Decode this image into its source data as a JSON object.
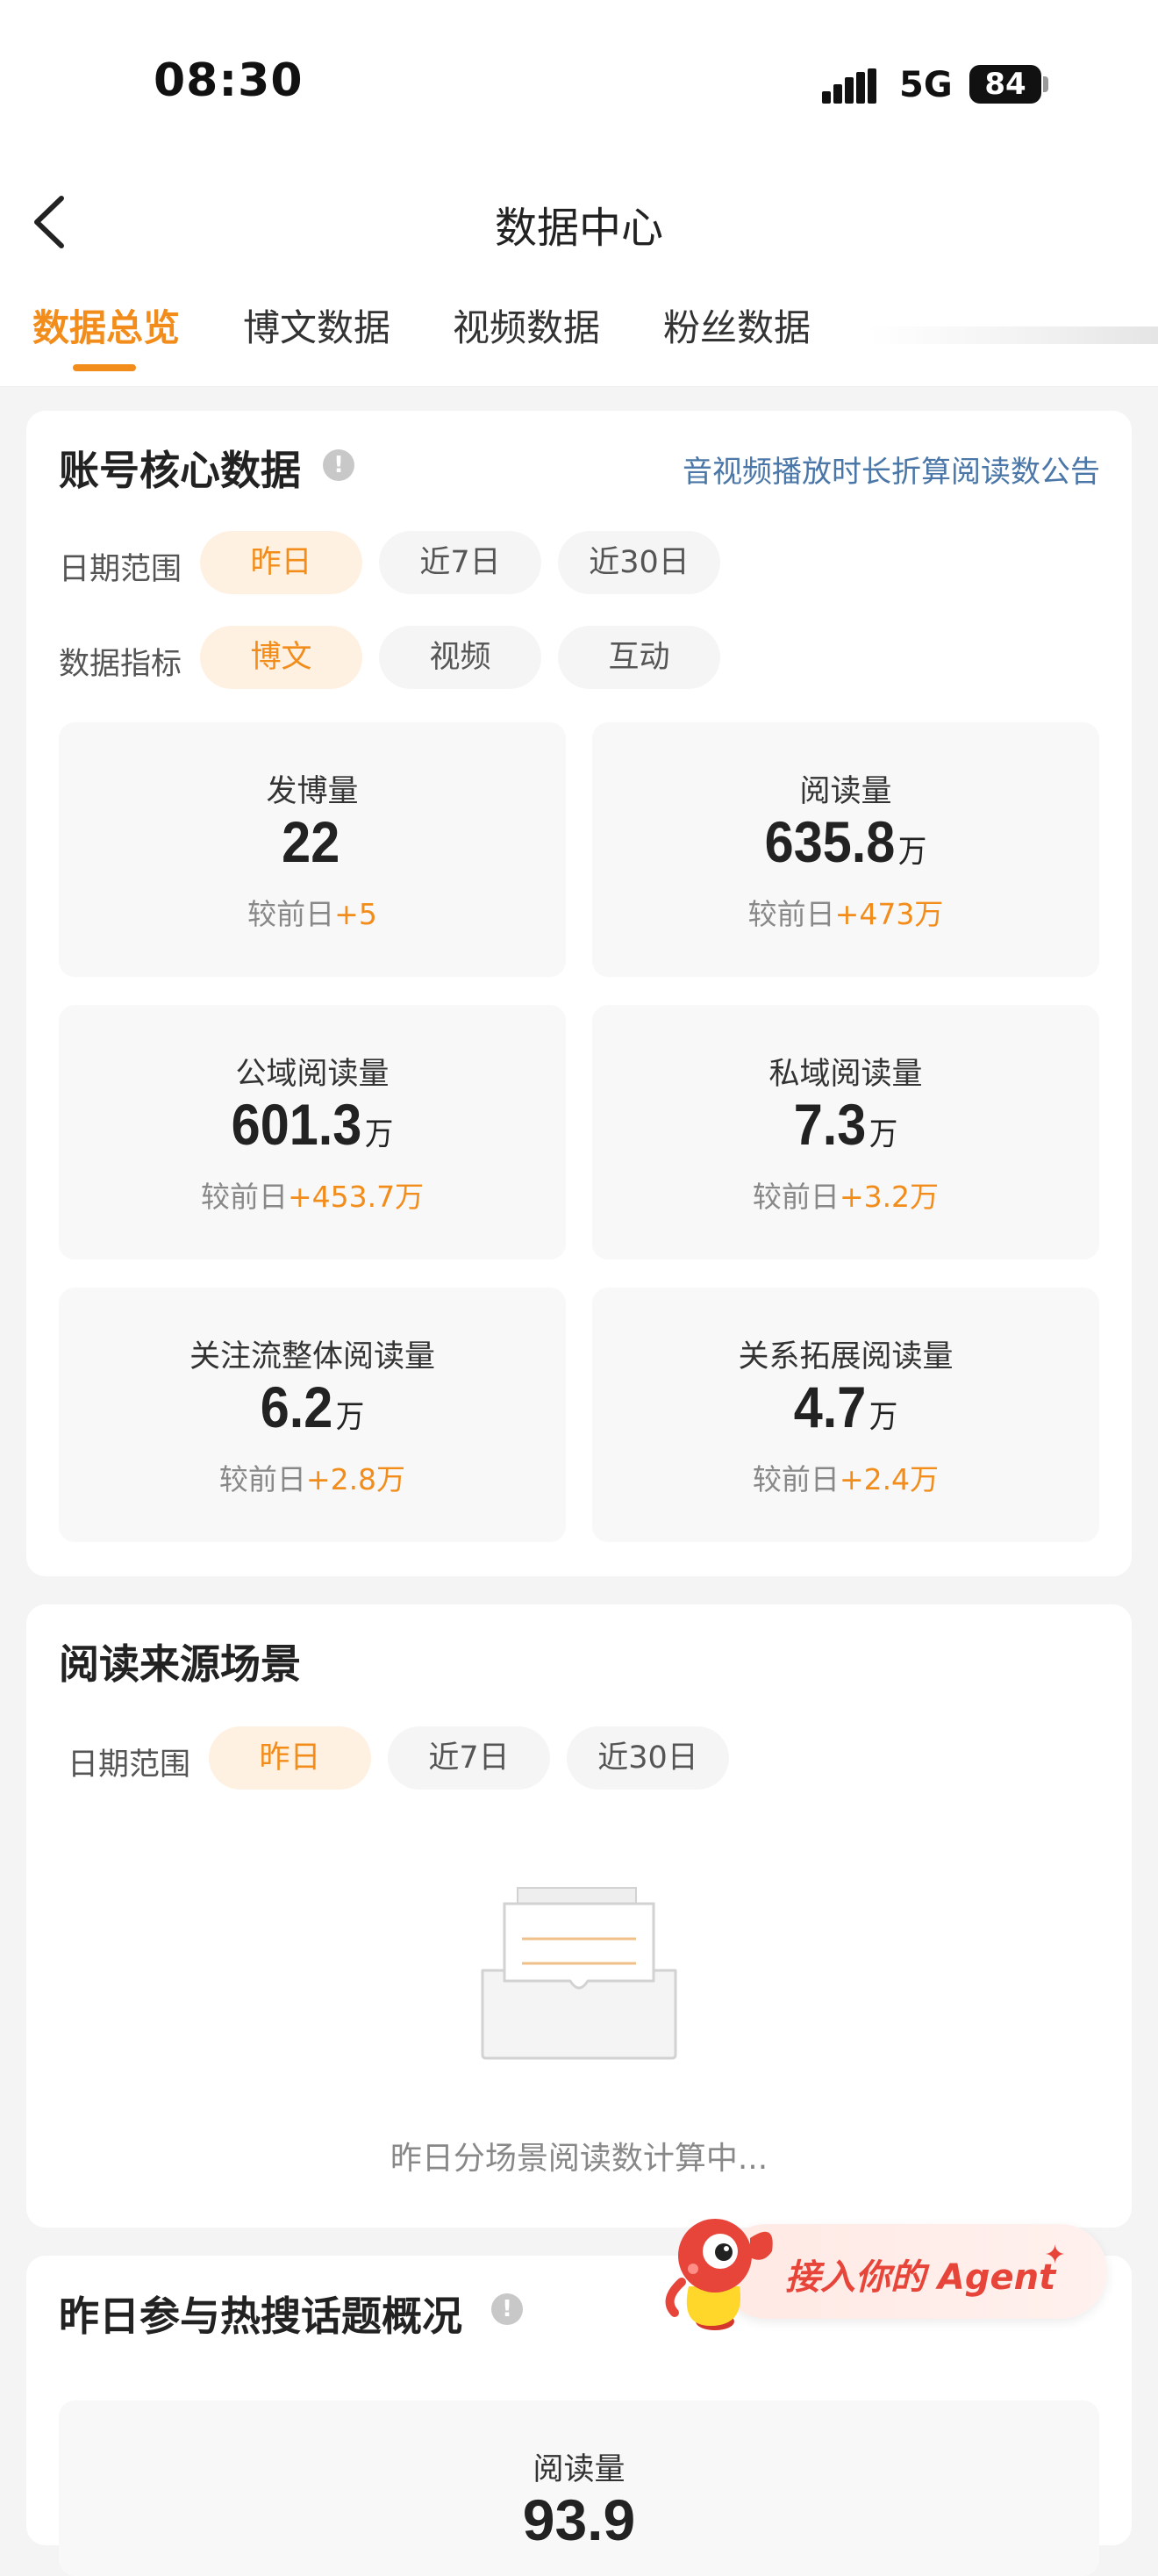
{
  "status_bar": {
    "time": "08:30",
    "network": "5G",
    "battery": "84"
  },
  "nav": {
    "title": "数据中心",
    "back_icon": "chevron-left-icon"
  },
  "tabs": [
    {
      "label": "数据总览",
      "active": true
    },
    {
      "label": "博文数据",
      "active": false
    },
    {
      "label": "视频数据",
      "active": false
    },
    {
      "label": "粉丝数据",
      "active": false
    }
  ],
  "core": {
    "title": "账号核心数据",
    "notice_link": "音视频播放时长折算阅读数公告",
    "date_label": "日期范围",
    "date_options": [
      "昨日",
      "近7日",
      "近30日"
    ],
    "metric_label": "数据指标",
    "metric_options": [
      "博文",
      "视频",
      "互动"
    ],
    "compare_prefix": "较前日",
    "metrics": [
      {
        "label": "发博量",
        "value": "22",
        "unit": "",
        "delta": "+5"
      },
      {
        "label": "阅读量",
        "value": "635.8",
        "unit": "万",
        "delta": "+473万"
      },
      {
        "label": "公域阅读量",
        "value": "601.3",
        "unit": "万",
        "delta": "+453.7万"
      },
      {
        "label": "私域阅读量",
        "value": "7.3",
        "unit": "万",
        "delta": "+3.2万"
      },
      {
        "label": "关注流整体阅读量",
        "value": "6.2",
        "unit": "万",
        "delta": "+2.8万"
      },
      {
        "label": "关系拓展阅读量",
        "value": "4.7",
        "unit": "万",
        "delta": "+2.4万"
      }
    ]
  },
  "source": {
    "title": "阅读来源场景",
    "date_label": "日期范围",
    "date_options": [
      "昨日",
      "近7日",
      "近30日"
    ],
    "empty_text": "昨日分场景阅读数计算中..."
  },
  "hot": {
    "title": "昨日参与热搜话题概况",
    "metric_label": "阅读量",
    "metric_value_partial": "93.9"
  },
  "agent": {
    "label": "接入你的 Agent"
  },
  "colors": {
    "accent": "#f28c1a",
    "link": "#4a77a8",
    "agent": "#e8453a"
  }
}
